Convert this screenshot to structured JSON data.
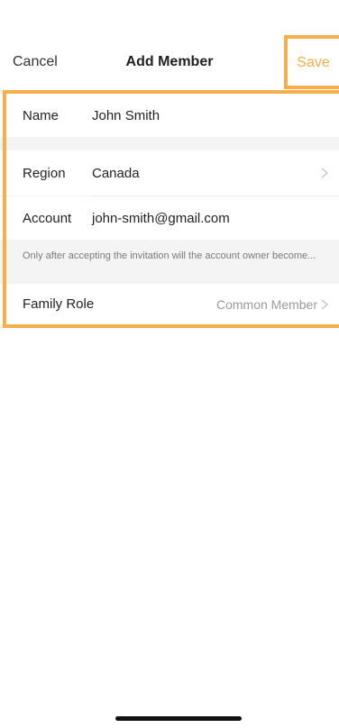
{
  "nav": {
    "cancel_label": "Cancel",
    "title": "Add Member",
    "save_label": "Save"
  },
  "form": {
    "name_label": "Name",
    "name_value": "John Smith",
    "region_label": "Region",
    "region_value": "Canada",
    "account_label": "Account",
    "account_value": "john-smith@gmail.com",
    "note": "Only after accepting the invitation will the account owner become...",
    "role_label": "Family Role",
    "role_value": "Common Member"
  },
  "colors": {
    "accent": "#f6ae4a",
    "background_band": "#f4f4f5"
  },
  "icons": {
    "chevron": "chevron-right-icon"
  }
}
